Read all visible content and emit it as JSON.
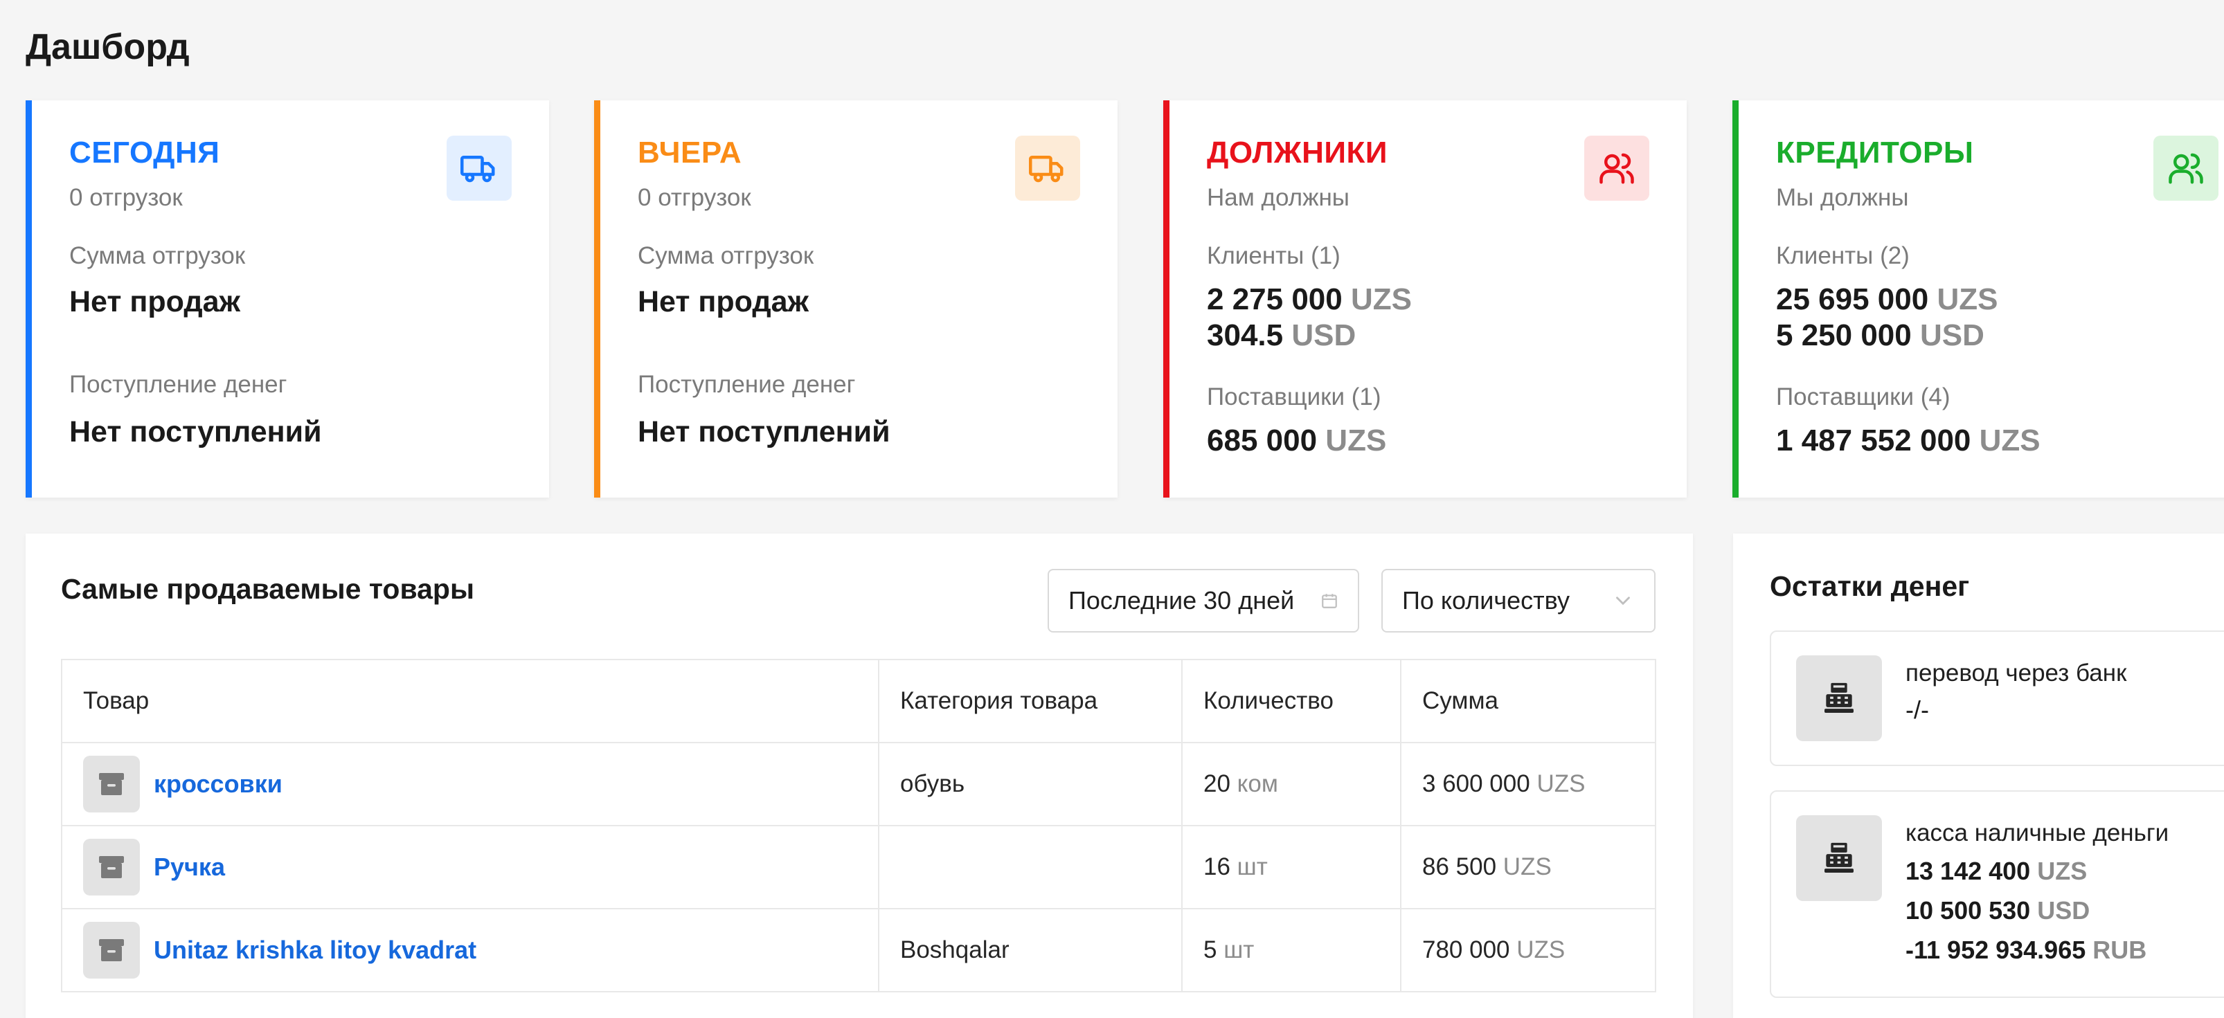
{
  "page": {
    "title": "Дашборд"
  },
  "cards": {
    "today": {
      "title": "СЕГОДНЯ",
      "subtitle": "0 отгрузок",
      "label1": "Сумма отгрузок",
      "value1": "Нет продаж",
      "label2": "Поступление денег",
      "value2": "Нет поступлений",
      "icon": "truck-icon",
      "color": "#1677ff"
    },
    "yesterday": {
      "title": "ВЧЕРА",
      "subtitle": "0 отгрузок",
      "label1": "Сумма отгрузок",
      "value1": "Нет продаж",
      "label2": "Поступление денег",
      "value2": "Нет поступлений",
      "icon": "truck-icon",
      "color": "#fa8c16"
    },
    "debtors": {
      "title": "ДОЛЖНИКИ",
      "subtitle": "Нам должны",
      "clients_label": "Клиенты (1)",
      "clients_amounts": [
        {
          "num": "2 275 000",
          "cur": "UZS"
        },
        {
          "num": "304.5",
          "cur": "USD"
        }
      ],
      "suppliers_label": "Поставщики (1)",
      "suppliers_amounts": [
        {
          "num": "685 000",
          "cur": "UZS"
        }
      ],
      "icon": "users-icon",
      "color": "#e8121b"
    },
    "creditors": {
      "title": "КРЕДИТОРЫ",
      "subtitle": "Мы должны",
      "clients_label": "Клиенты (2)",
      "clients_amounts": [
        {
          "num": "25 695 000",
          "cur": "UZS"
        },
        {
          "num": "5 250 000",
          "cur": "USD"
        }
      ],
      "suppliers_label": "Поставщики (4)",
      "suppliers_amounts": [
        {
          "num": "1 487 552 000",
          "cur": "UZS"
        }
      ],
      "icon": "users-icon",
      "color": "#1aad2c"
    }
  },
  "top_products": {
    "title": "Самые продаваемые товары",
    "period_value": "Последние 30 дней",
    "sort_value": "По количеству",
    "columns": [
      "Товар",
      "Категория товара",
      "Количество",
      "Сумма"
    ],
    "rows": [
      {
        "name": "кроссовки",
        "category": "обувь",
        "qty": "20",
        "unit": "ком",
        "sum": "3 600 000",
        "cur": "UZS"
      },
      {
        "name": "Ручка",
        "category": "",
        "qty": "16",
        "unit": "шт",
        "sum": "86 500",
        "cur": "UZS"
      },
      {
        "name": "Unitaz krishka litoy kvadrat",
        "category": "Boshqalar",
        "qty": "5",
        "unit": "шт",
        "sum": "780 000",
        "cur": "UZS"
      }
    ]
  },
  "cash": {
    "title": "Остатки денег",
    "accounts": [
      {
        "name": "перевод через банк",
        "lines": [
          {
            "num": "-/-",
            "cur": ""
          }
        ]
      },
      {
        "name": "касса наличные деньги",
        "lines": [
          {
            "num": "13 142 400",
            "cur": "UZS"
          },
          {
            "num": "10 500 530",
            "cur": "USD"
          },
          {
            "num": "-11 952 934.965",
            "cur": "RUB"
          }
        ]
      }
    ]
  }
}
